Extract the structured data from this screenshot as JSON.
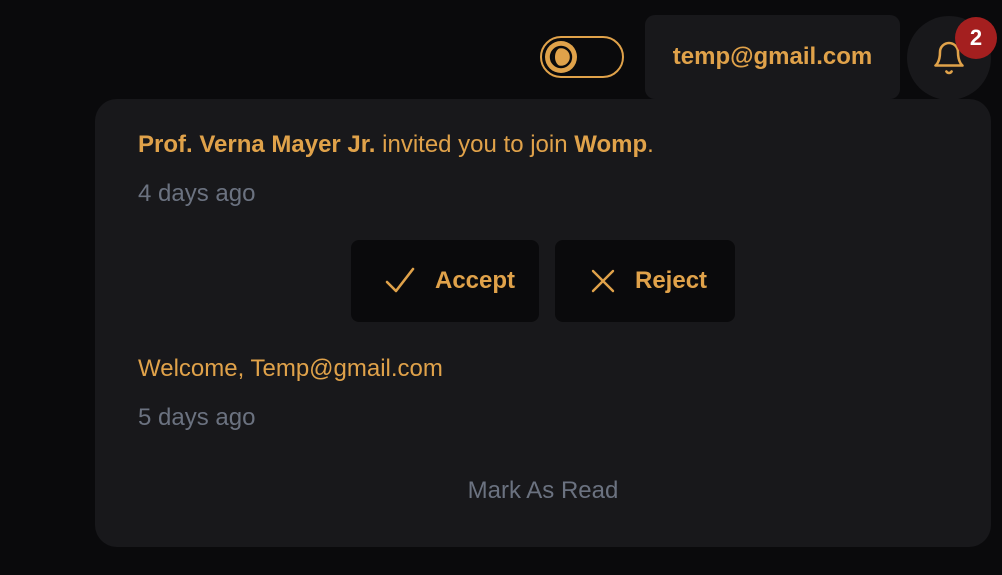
{
  "header": {
    "user_email": "temp@gmail.com",
    "notification_count": "2"
  },
  "notifications": [
    {
      "sender": "Prof. Verna Mayer Jr.",
      "text": " invited you to join ",
      "target": "Womp",
      "suffix": ".",
      "time": "4 days ago",
      "actions": {
        "accept_label": "Accept",
        "reject_label": "Reject"
      }
    },
    {
      "text": "Welcome, Temp@gmail.com",
      "time": "5 days ago"
    }
  ],
  "footer": {
    "mark_read_label": "Mark As Read"
  },
  "theme": {
    "accent": "#e0a24a",
    "panel_bg": "#18181b",
    "page_bg": "#0a0a0c",
    "muted_text": "#6b7280",
    "badge_bg": "#a41f1f"
  },
  "icons": {
    "theme_toggle": "moon-icon",
    "notifications": "bell-icon",
    "accept": "check-icon",
    "reject": "close-icon"
  }
}
